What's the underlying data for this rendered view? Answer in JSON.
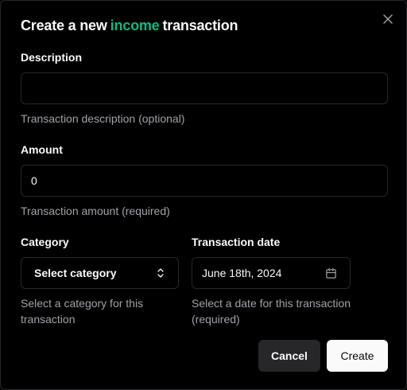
{
  "dialog": {
    "title_prefix": "Create a new",
    "title_type": "income",
    "title_suffix": "transaction",
    "accent_color": "#10b981"
  },
  "description": {
    "label": "Description",
    "value": "",
    "placeholder": "",
    "hint": "Transaction description (optional)"
  },
  "amount": {
    "label": "Amount",
    "value": "0",
    "hint": "Transaction amount (required)"
  },
  "category": {
    "label": "Category",
    "selected": "Select category",
    "hint": "Select a category for this transaction"
  },
  "date": {
    "label": "Transaction date",
    "value": "June 18th, 2024",
    "hint": "Select a date for this transaction (required)"
  },
  "actions": {
    "cancel_label": "Cancel",
    "create_label": "Create"
  },
  "icons": {
    "close": "close-icon",
    "chevrons": "chevrons-up-down-icon",
    "calendar": "calendar-icon"
  }
}
